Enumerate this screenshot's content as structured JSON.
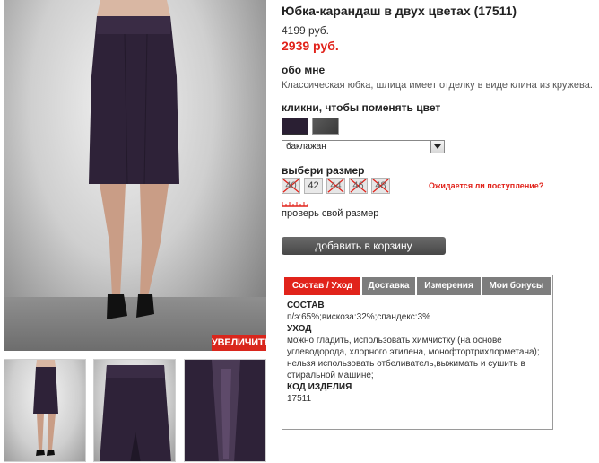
{
  "product": {
    "title": "Юбка-карандаш в двух цветах (17511)",
    "old_price": "4199 руб.",
    "new_price": "2939 руб."
  },
  "about": {
    "heading": "обо мне",
    "description": "Классическая юбка, шлица имеет отделку в виде клина из кружева."
  },
  "color": {
    "heading": "кликни, чтобы поменять цвет",
    "swatches": [
      {
        "name": "баклажан",
        "color": "#2a1f33"
      },
      {
        "name": "серый",
        "color": "#4a4a4a"
      }
    ],
    "selected": "баклажан"
  },
  "size": {
    "heading": "выбери размер",
    "sizes": [
      {
        "label": "40",
        "available": false
      },
      {
        "label": "42",
        "available": true
      },
      {
        "label": "44",
        "available": false
      },
      {
        "label": "46",
        "available": false
      },
      {
        "label": "48",
        "available": false
      }
    ],
    "expect_link": "Ожидается ли поступление?",
    "check_link": "проверь свой размер"
  },
  "cart": {
    "button_label": "добавить в корзину"
  },
  "gallery": {
    "zoom_label": "УВЕЛИЧИТЬ",
    "thumbnails": 3
  },
  "tabs": {
    "items": [
      "Состав / Уход",
      "Доставка",
      "Измерения",
      "Мои бонусы"
    ],
    "active": 0,
    "content": {
      "composition_heading": "СОСТАВ",
      "composition": "п/э:65%;вискоза:32%;спандекс:3%",
      "care_heading": "УХОД",
      "care": "можно гладить, использовать химчистку (на основе углеводорода, хлорного этилена, монофтортрихлорметана); нельзя использовать отбеливатель,выжимать и сушить в стиральной машине;",
      "code_heading": "КОД ИЗДЕЛИЯ",
      "code": "17511"
    }
  },
  "colors": {
    "accent": "#e1231b",
    "dark_button": "#555555",
    "skirt": "#2e2238"
  }
}
